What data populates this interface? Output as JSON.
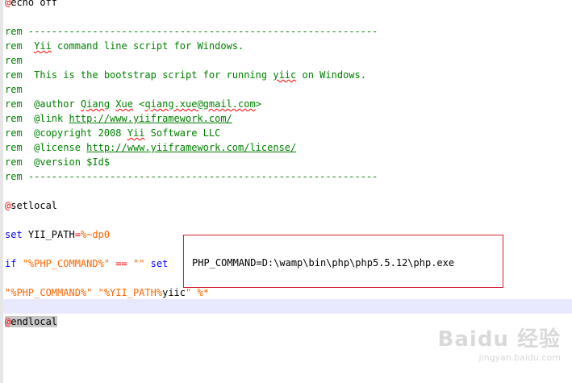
{
  "editor": {
    "lines": [
      {
        "prefix": "@",
        "text": "echo off"
      },
      {
        "text": ""
      },
      {
        "rem": "rem",
        "text": " ------------------------------------------------------------"
      },
      {
        "rem": "rem",
        "text_a": "  ",
        "squig": "Yii",
        "text_b": " command line script for Windows."
      },
      {
        "rem": "rem",
        "text": ""
      },
      {
        "rem": "rem",
        "text_a": "  This is the bootstrap script for running ",
        "squig": "yiic",
        "text_b": " on Windows."
      },
      {
        "rem": "rem",
        "text": ""
      },
      {
        "rem": "rem",
        "text_a": "  @author ",
        "squig": "Qiang",
        "text_b": " ",
        "squig2": "Xue",
        "text_c": " <",
        "squig3": "qiang.xue@gmail.com",
        "text_d": ">"
      },
      {
        "rem": "rem",
        "text_a": "  @link ",
        "link": "http://www.yiiframework.com/"
      },
      {
        "rem": "rem",
        "text_a": "  @copyright 2008 ",
        "squig": "Yii",
        "text_b": " Software LLC"
      },
      {
        "rem": "rem",
        "text_a": "  @license ",
        "link": "http://www.yiiframework.com/license/"
      },
      {
        "rem": "rem",
        "text": "  @version $Id$"
      },
      {
        "rem": "rem",
        "text": " ------------------------------------------------------------"
      },
      {
        "text": ""
      },
      {
        "prefix": "@",
        "text": "setlocal"
      },
      {
        "text": ""
      },
      {
        "kw": "set",
        "text_a": " YII_PATH",
        "op": "=",
        "var": "%~dp0"
      },
      {
        "text": ""
      },
      {
        "kw": "if",
        "text_a": " ",
        "str1": "\"%PHP_COMMAND%\"",
        "text_b": " ",
        "op": "==",
        "text_c": " ",
        "str2": "\"\"",
        "text_d": " ",
        "kw2": "set"
      },
      {
        "text": ""
      },
      {
        "str1": "\"%PHP_COMMAND%\"",
        "text_a": " ",
        "str2": "\"%YII_PATH%",
        "text_b": "yiic",
        "str3": "\"",
        "text_c": " ",
        "var": "%*"
      },
      {
        "text": ""
      },
      {
        "prefix": "@",
        "text": "endlocal"
      }
    ],
    "highlight_text": "PHP_COMMAND=D:\\wamp\\bin\\php\\php5.5.12\\php.exe"
  },
  "watermark": {
    "main": "Baidu 经验",
    "sub": "jingyan.baidu.com"
  }
}
